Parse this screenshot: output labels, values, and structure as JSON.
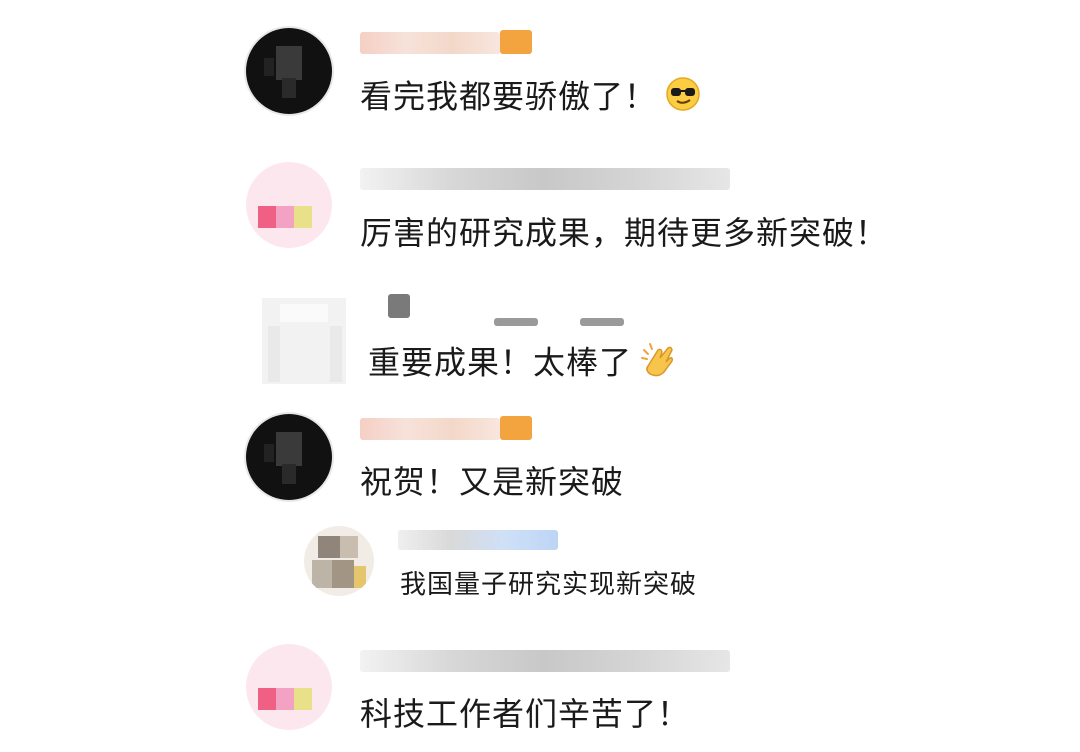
{
  "comments": [
    {
      "text": "看完我都要骄傲了！",
      "emoji": "sunglasses-face"
    },
    {
      "text": "厉害的研究成果，期待更多新突破！"
    },
    {
      "text": "重要成果！太棒了",
      "emoji": "clapping-hands"
    },
    {
      "text": "祝贺！又是新突破"
    },
    {
      "text": "我国量子研究实现新突破"
    },
    {
      "text": "科技工作者们辛苦了！"
    }
  ]
}
